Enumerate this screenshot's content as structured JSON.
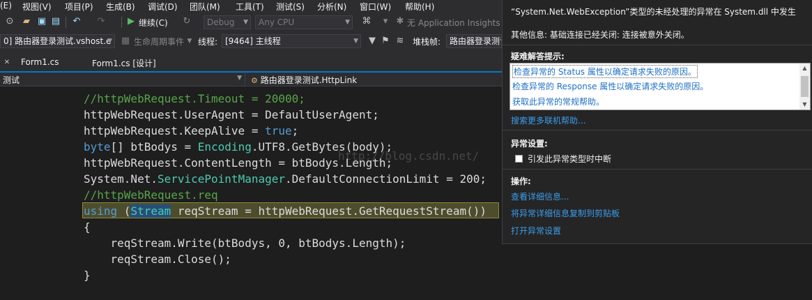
{
  "menu": {
    "items": [
      "(E)",
      "视图(V)",
      "项目(P)",
      "生成(B)",
      "调试(D)",
      "团队(M)",
      "工具(T)",
      "测试(S)",
      "分析(N)",
      "窗口(W)",
      "帮助(H)"
    ]
  },
  "toolbar": {
    "continue_label": "继续(C)",
    "config_value": "Debug",
    "platform_value": "Any CPU",
    "insights_label": "无 Application Insights"
  },
  "debug_location": {
    "process_value": "0] 路由器登录测试.vshost.e",
    "lifecycle_label": "生命周期事件",
    "thread_label": "线程:",
    "thread_value": "[9464] 主线程",
    "stackframe_label": "堆栈帧:",
    "stackframe_value": "路由器登录测试"
  },
  "tabs": [
    {
      "label": "Form1.cs"
    },
    {
      "label": "Form1.cs [设计]"
    }
  ],
  "navbar": {
    "left": "测试",
    "right": "路由器登录测试.HttpLink"
  },
  "code": {
    "line1": "//httpWebRequest.Timeout = 20000;",
    "line2a": "httpWebRequest.UserAgent = DefaultUserAgent;",
    "line3a": "httpWebRequest.KeepAlive = ",
    "line3b": "true",
    "line3c": ";",
    "line4a": "byte",
    "line4b": "[] btBodys = ",
    "line4c": "Encoding",
    "line4d": ".UTF8.GetBytes(body);",
    "line5": "httpWebRequest.ContentLength = btBodys.Length;",
    "line6a": "System.Net.",
    "line6b": "ServicePointManager",
    "line6c": ".DefaultConnectionLimit = 200;",
    "line7": "//httpWebRequest.req",
    "line8a": "using",
    "line8b": " (",
    "line8c": "Stream",
    "line8d": " reqStream = httpWebRequest.GetRequestStream())",
    "line9": "{",
    "line10": "    reqStream.Write(btBodys, 0, btBodys.Length);",
    "line11": "    reqStream.Close();",
    "line12": "}"
  },
  "watermark": "http://blog.csdn.net/",
  "exception": {
    "title": "“System.Net.WebException”类型的未经处理的异常在 System.dll 中发生",
    "info": "其他信息: 基础连接已经关闭: 连接被意外关闭。",
    "tips_heading": "疑难解答提示:",
    "tips": [
      "检查异常的 Status 属性以确定请求失败的原因。",
      "检查异常的 Response 属性以确定请求失败的原因。",
      "获取此异常的常规帮助。"
    ],
    "search_link": "搜索更多联机帮助...",
    "settings_heading": "异常设置:",
    "break_checkbox_label": "引发此异常类型时中断",
    "actions_heading": "操作:",
    "actions": [
      "查看详细信息...",
      "将异常详细信息复制到剪贴板",
      "打开异常设置"
    ]
  },
  "colors": {
    "accent": "#007acc",
    "link": "#3c9ce8",
    "comment": "#57a64a",
    "keyword": "#569cd6",
    "type": "#4ec9b0"
  }
}
